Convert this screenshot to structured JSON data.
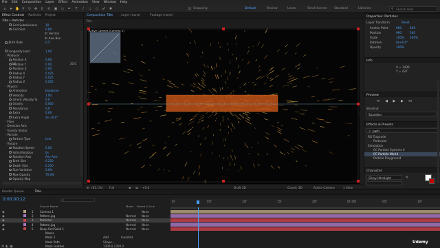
{
  "menu": [
    "File",
    "Edit",
    "Composition",
    "Layer",
    "Effect",
    "Animation",
    "View",
    "Window",
    "Help"
  ],
  "toolbar": {
    "snapping_label": "Snapping",
    "workspaces": [
      "Default",
      "Review",
      "Learn",
      "Small Screen",
      "Standard",
      "Libraries"
    ],
    "search_placeholder": "Search Help"
  },
  "left_panel": {
    "tabs": [
      "Effect Controls",
      "Particles",
      "Project"
    ],
    "header": "Title • Particles",
    "rows": [
      {
        "name": "Grid Subdivisions",
        "value": "10"
      },
      {
        "name": "Grid Size",
        "value": "0.80"
      },
      {
        "name": "Horizon",
        "value": ""
      },
      {
        "name": "Axis Box",
        "value": ""
      },
      {
        "name": "Birth Rate",
        "value": "0.5"
      },
      {
        "name": "Longevity (sec)",
        "value": "1.00"
      },
      {
        "name": "Producer",
        "value": ""
      },
      {
        "name": "Position X",
        "value": "0.00"
      },
      {
        "name": "Position Y",
        "value": "0.00"
      },
      {
        "name": "Position Z",
        "value": "0.00"
      },
      {
        "name": "Radius X",
        "value": "0.025"
      },
      {
        "name": "Radius Y",
        "value": "0.025"
      },
      {
        "name": "Radius Z",
        "value": "0.025"
      },
      {
        "name": "Physics",
        "value": ""
      },
      {
        "name": "Animation",
        "value": "Explosive"
      },
      {
        "name": "Velocity",
        "value": "1.00"
      },
      {
        "name": "Inherit Velocity %",
        "value": "0.0"
      },
      {
        "name": "Gravity",
        "value": "0.000"
      },
      {
        "name": "Resistance",
        "value": "0.0"
      },
      {
        "name": "Extra",
        "value": "0.00"
      },
      {
        "name": "Extra Angle",
        "value": "1x +0.0°"
      },
      {
        "name": "Floor",
        "value": ""
      },
      {
        "name": "Direction Axis",
        "value": ""
      },
      {
        "name": "Gravity Vector",
        "value": ""
      },
      {
        "name": "Particle",
        "value": ""
      },
      {
        "name": "Particle Type",
        "value": "Line"
      },
      {
        "name": "Texture",
        "value": ""
      },
      {
        "name": "Rotation Speed",
        "value": "0.00"
      },
      {
        "name": "Initial Rotation",
        "value": "0x"
      },
      {
        "name": "Rotation Axis",
        "value": "Any Axis"
      },
      {
        "name": "Birth Size",
        "value": "0.250"
      },
      {
        "name": "Death Size",
        "value": "0.250"
      },
      {
        "name": "Size Variation",
        "value": "0.0%"
      },
      {
        "name": "Max Opacity",
        "value": "75.0%"
      },
      {
        "name": "Opacity Map",
        "value": ""
      }
    ],
    "slider_min": "0.0",
    "slider_max": "20.0"
  },
  "comp_panel": {
    "tabs": [
      "Composition Title",
      "Layer (none)",
      "Footage (none)"
    ],
    "camera_label": "Active Camera (Camera 1)",
    "bottom_bar": {
      "zoom": "(81.1%)",
      "resolution": "Full",
      "timecode": "+0.0",
      "draft": "Draft 3D",
      "renderer": "Classic 3D",
      "view": "Active Camera",
      "views": "1 View"
    }
  },
  "right_panel": {
    "header": "Properties: Particles",
    "transform_label": "Layer Transform",
    "reset_label": "Reset",
    "transform": [
      {
        "name": "Anchor Point",
        "v1": "960",
        "v2": "540"
      },
      {
        "name": "Position",
        "v1": "960",
        "v2": "540"
      },
      {
        "name": "Scale",
        "v1": "100%",
        "v2": "100%"
      },
      {
        "name": "Rotation",
        "v1": "0x+0.0°",
        "v2": ""
      },
      {
        "name": "Opacity",
        "v1": "100%",
        "v2": ""
      }
    ],
    "info_label": "Info",
    "info_values": [
      "X = 1436",
      "Y = 437"
    ],
    "preview_label": "Preview",
    "shortcut_label": "Shortcut",
    "shortcut_value": "Spacebar",
    "effects_label": "Effects & Presets",
    "effects_search": "parti",
    "effects_items": [
      "RG Trapcode",
      "Particular",
      "Simulation",
      "CC Particle Systems II",
      "CC Particle World",
      "Particle Playground"
    ],
    "character_label": "Character",
    "font_value": "Gilroy-UltraLight"
  },
  "timeline": {
    "tabs": [
      "Render Queue",
      "Title"
    ],
    "timecode": "0:00:00:12",
    "columns": {
      "source": "Source Name",
      "mode": "Mode",
      "trkmat": "TrkMat",
      "parent": "Parent & Link"
    },
    "layers": [
      {
        "num": "1",
        "name": "Camera 1",
        "mode": "",
        "parent": "None",
        "color": "#b4a07a"
      },
      {
        "num": "2",
        "name": "Pattern.jpg",
        "mode": "Normal",
        "parent": "None",
        "color": "#a878c0"
      },
      {
        "num": "3",
        "name": "Particles",
        "mode": "Normal",
        "parent": "None",
        "color": "#c8414a"
      },
      {
        "num": "4",
        "name": "Pattern.jpg",
        "mode": "Normal",
        "parent": "None",
        "color": "#a878c0"
      },
      {
        "num": "5",
        "name": "Deep Red Solid 1",
        "mode": "Normal",
        "parent": "None",
        "color": "#c8414a"
      },
      {
        "num": "",
        "name": "Masks",
        "mode": "",
        "parent": "",
        "color": ""
      },
      {
        "num": "",
        "name": "Mask 1",
        "mode": "Add",
        "parent": "Inverted",
        "color": ""
      },
      {
        "num": "",
        "name": "Mask Path",
        "mode": "Shape...",
        "parent": "",
        "color": ""
      },
      {
        "num": "",
        "name": "Mask Feather",
        "mode": "1300.0,1300.0",
        "parent": "",
        "color": ""
      }
    ],
    "ruler": [
      "0f",
      "05f",
      "10f",
      "15f",
      "20f",
      "01:00f",
      "05f",
      "10f"
    ],
    "watermark": "Udemy"
  }
}
